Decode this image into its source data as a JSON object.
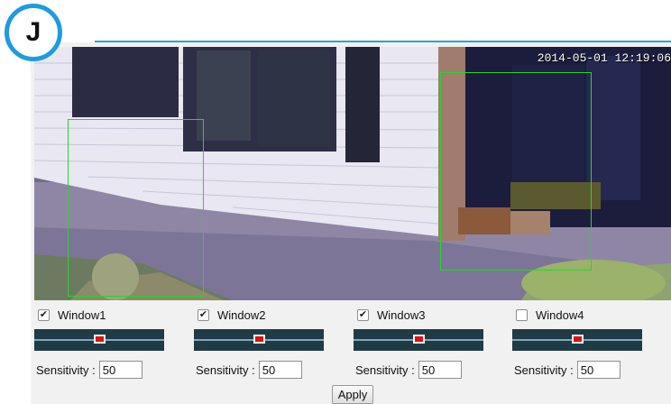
{
  "badge": {
    "letter": "J"
  },
  "video": {
    "timestamp": "2014-05-01 12:19:06"
  },
  "motion_windows": [
    {
      "label": "Window1",
      "checked": true,
      "sensitivity": "50"
    },
    {
      "label": "Window2",
      "checked": true,
      "sensitivity": "50"
    },
    {
      "label": "Window3",
      "checked": true,
      "sensitivity": "50"
    },
    {
      "label": "Window4",
      "checked": false,
      "sensitivity": "50"
    }
  ],
  "sensitivity_label": "Sensitivity :",
  "apply_label": "Apply",
  "colors": {
    "accent": "#1e9be0",
    "motion_window_outline": "#29d429",
    "slider_background": "#1f3b47",
    "slider_thumb": "#d51515"
  },
  "icons": {
    "checkbox_checked": "checkmark-icon"
  }
}
